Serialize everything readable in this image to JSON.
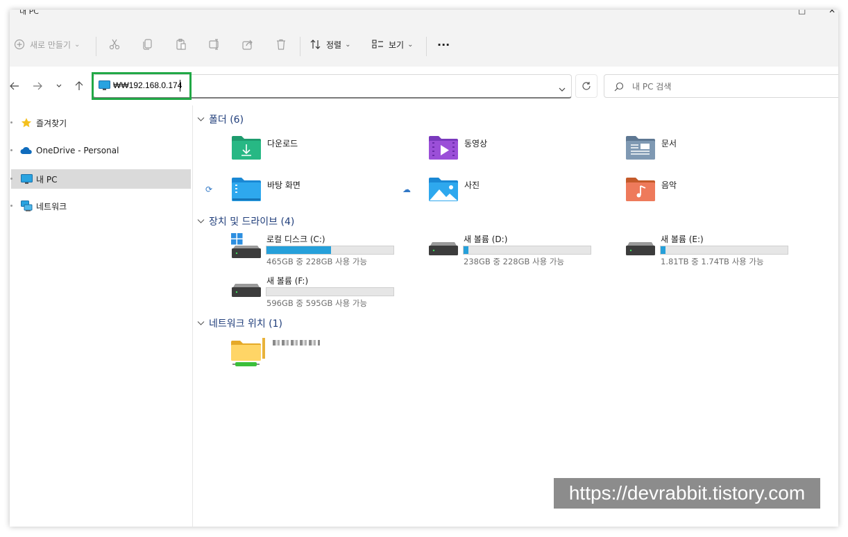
{
  "window": {
    "title": "내 PC"
  },
  "toolbar": {
    "new_label": "새로 만들기",
    "sort_label": "정렬",
    "view_label": "보기",
    "more_label": "···",
    "dropdown_glyph": "⌄"
  },
  "navbar": {
    "address_value": "₩₩192.168.0.174",
    "search_placeholder": "내 PC 검색"
  },
  "sidebar": {
    "items": [
      {
        "label": "즐겨찾기",
        "icon": "star-icon"
      },
      {
        "label": "OneDrive - Personal",
        "icon": "onedrive-cloud-icon"
      },
      {
        "label": "내 PC",
        "icon": "monitor-icon",
        "selected": true
      },
      {
        "label": "네트워크",
        "icon": "network-icon"
      }
    ]
  },
  "groups": {
    "folders": "폴더 (6)",
    "drives": "장치 및 드라이브 (4)",
    "network": "네트워크 위치 (1)"
  },
  "folders": [
    {
      "label": "다운로드",
      "icon": "downloads-folder-icon"
    },
    {
      "label": "동영상",
      "icon": "videos-folder-icon"
    },
    {
      "label": "문서",
      "icon": "documents-folder-icon"
    },
    {
      "label": "바탕 화면",
      "icon": "desktop-folder-icon"
    },
    {
      "label": "사진",
      "icon": "pictures-folder-icon"
    },
    {
      "label": "음악",
      "icon": "music-folder-icon"
    }
  ],
  "drives": [
    {
      "name": "로컬 디스크 (C:)",
      "free": "465GB 중 228GB 사용 가능",
      "used_fraction": 0.51
    },
    {
      "name": "새 볼륨 (D:)",
      "free": "238GB 중 228GB 사용 가능",
      "used_fraction": 0.04
    },
    {
      "name": "새 볼륨 (E:)",
      "free": "1.81TB 중 1.74TB 사용 가능",
      "used_fraction": 0.04
    },
    {
      "name": "새 볼륨 (F:)",
      "free": "596GB 중 595GB 사용 가능",
      "used_fraction": 0.0
    }
  ],
  "watermark": "https://devrabbit.tistory.com",
  "colors": {
    "accent": "#26a0da",
    "highlight_box": "#21a846",
    "group_text": "#1f3d7a"
  }
}
